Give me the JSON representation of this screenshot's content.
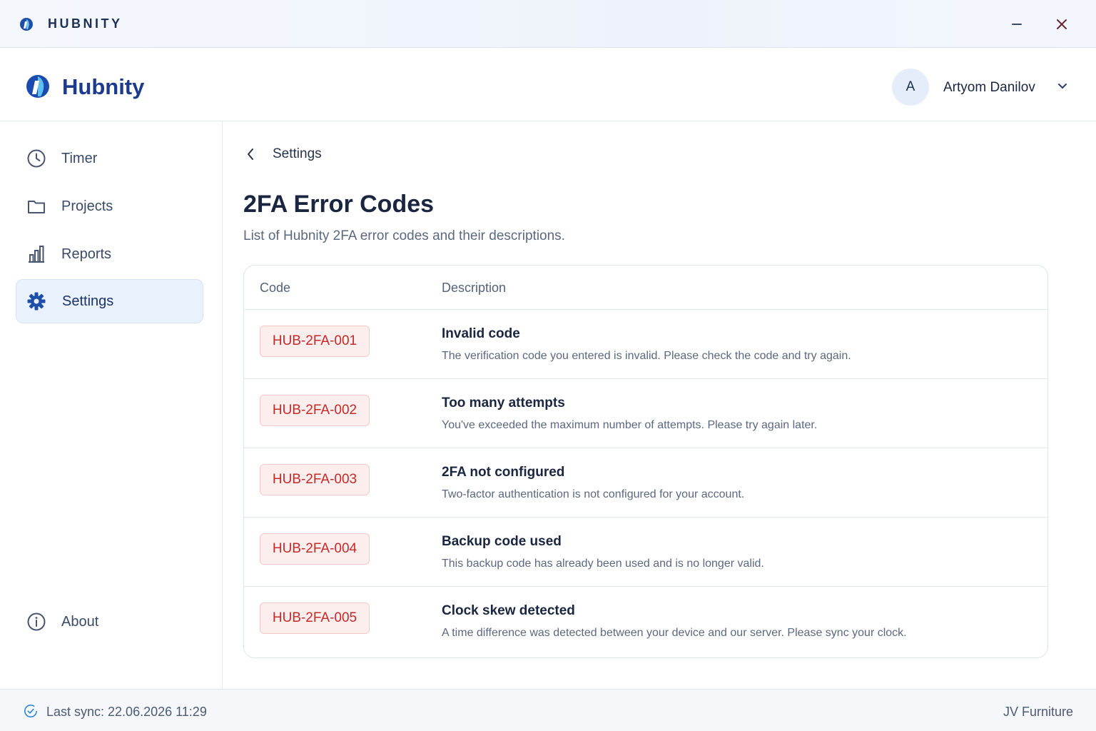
{
  "titlebar": {
    "title": "HUBNITY",
    "icons": [
      "hubnity-logo-icon",
      "minimize-icon",
      "close-icon"
    ]
  },
  "header": {
    "brand": "Hubnity",
    "avatar_initial": "A",
    "user_name": "Artyom Danilov",
    "icons": [
      "hubnity-logo-icon",
      "chevron-down-icon"
    ]
  },
  "sidebar": {
    "items": [
      {
        "label": "Timer",
        "icon": "clock-icon",
        "active": false
      },
      {
        "label": "Projects",
        "icon": "folder-icon",
        "active": false
      },
      {
        "label": "Reports",
        "icon": "bar-chart-icon",
        "active": false
      },
      {
        "label": "Settings",
        "icon": "gear-icon",
        "active": true
      }
    ],
    "about": {
      "label": "About",
      "icon": "info-icon"
    }
  },
  "main": {
    "breadcrumb": "Settings",
    "title": "2FA Error Codes",
    "subtitle": "List of Hubnity 2FA error codes and their descriptions.",
    "table": {
      "columns": [
        "Code",
        "Description"
      ],
      "rows": [
        {
          "code": "HUB-2FA-001",
          "title": "Invalid code",
          "description": "The verification code you entered is invalid. Please check the code and try again."
        },
        {
          "code": "HUB-2FA-002",
          "title": "Too many attempts",
          "description": "You've exceeded the maximum number of attempts. Please try again later."
        },
        {
          "code": "HUB-2FA-003",
          "title": "2FA not configured",
          "description": "Two-factor authentication is not configured for your account."
        },
        {
          "code": "HUB-2FA-004",
          "title": "Backup code used",
          "description": "This backup code has already been used and is no longer valid."
        },
        {
          "code": "HUB-2FA-005",
          "title": "Clock skew detected",
          "description": "A time difference was detected between your device and our server. Please sync your clock."
        }
      ]
    }
  },
  "footer": {
    "sync_text": "Last sync: 22.06.2026 11:29",
    "org": "JV Furniture",
    "icon": "sync-check-icon"
  },
  "colors": {
    "brand": "#1c3b8c",
    "accent": "#1e66c8",
    "error_badge_bg": "#fdeeee",
    "error_badge_text": "#c62828",
    "active_nav_bg": "#e9f1fc"
  }
}
